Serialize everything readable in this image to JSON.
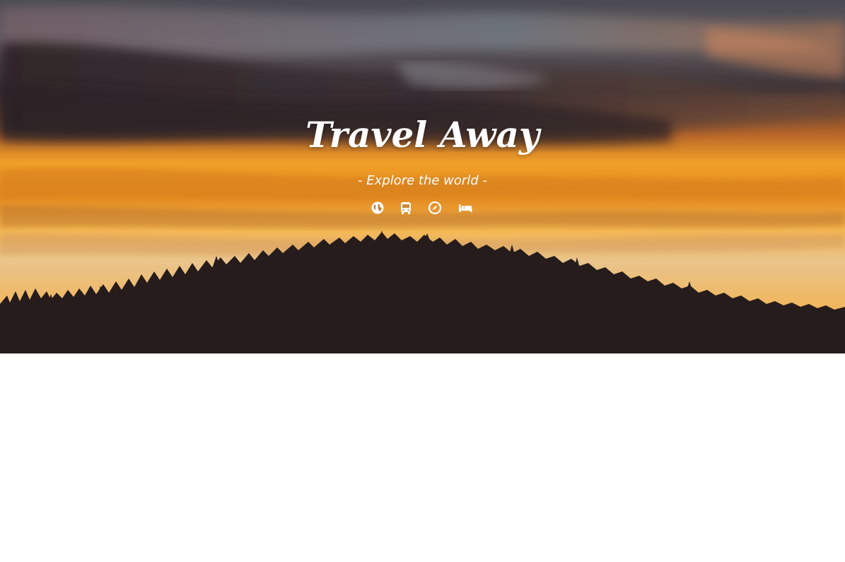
{
  "hero": {
    "title": "Travel Away",
    "tagline": "- Explore the world -",
    "icons": [
      "globe-icon",
      "bus-icon",
      "compass-icon",
      "bed-icon"
    ]
  },
  "colors": {
    "text": "#ffffff",
    "sky_top": "#3a3a44",
    "sky_orange": "#f2a21f",
    "hill": "#261c1c"
  }
}
